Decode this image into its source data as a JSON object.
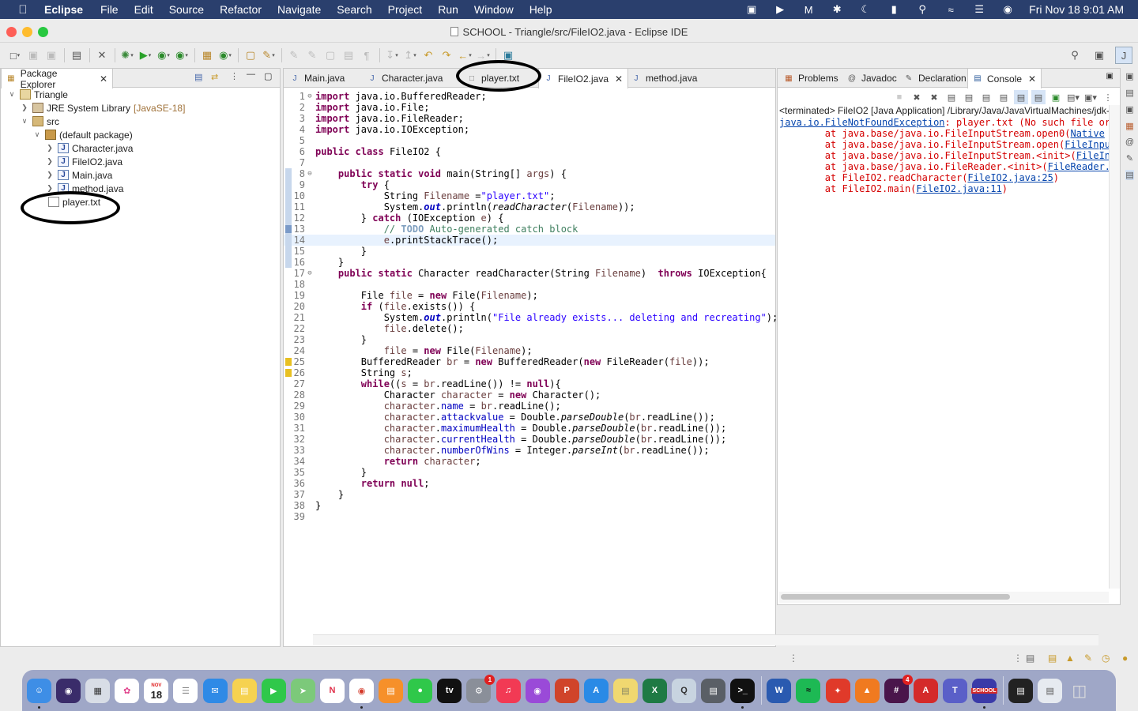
{
  "menubar": {
    "app": "Eclipse",
    "items": [
      "File",
      "Edit",
      "Source",
      "Refactor",
      "Navigate",
      "Search",
      "Project",
      "Run",
      "Window",
      "Help"
    ],
    "clock": "Fri Nov 18  9:01 AM"
  },
  "window": {
    "title": "SCHOOL - Triangle/src/FileIO2.java - Eclipse IDE"
  },
  "package_explorer": {
    "tab_label": "Package Explorer",
    "tree": [
      {
        "label": "Triangle",
        "suffix": "",
        "icon": "project-icon",
        "arrow": "v"
      },
      {
        "label": "JRE System Library",
        "suffix": "[JavaSE-18]",
        "icon": "jar-icon",
        "arrow": ">"
      },
      {
        "label": "src",
        "suffix": "",
        "icon": "source-folder-icon",
        "arrow": "v"
      },
      {
        "label": "(default package)",
        "suffix": "",
        "icon": "package-icon",
        "arrow": "v"
      },
      {
        "label": "Character.java",
        "suffix": "",
        "icon": "java-file-icon",
        "arrow": ">"
      },
      {
        "label": "FileIO2.java",
        "suffix": "",
        "icon": "java-file-icon",
        "arrow": ">"
      },
      {
        "label": "Main.java",
        "suffix": "",
        "icon": "java-file-icon",
        "arrow": ">"
      },
      {
        "label": "method.java",
        "suffix": "",
        "icon": "java-file-icon",
        "arrow": ">"
      },
      {
        "label": "player.txt",
        "suffix": "",
        "icon": "text-file-icon",
        "arrow": ""
      }
    ]
  },
  "editor": {
    "tabs": [
      {
        "label": "Main.java",
        "active": false
      },
      {
        "label": "Character.java",
        "active": false
      },
      {
        "label": "player.txt",
        "active": false
      },
      {
        "label": "FileIO2.java",
        "active": true
      },
      {
        "label": "method.java",
        "active": false
      }
    ],
    "lines": [
      "import java.io.BufferedReader;",
      "import java.io.File;",
      "import java.io.FileReader;",
      "import java.io.IOException;",
      "",
      "public class FileIO2 {",
      "",
      "    public static void main(String[] args) {",
      "        try {",
      "            String Filename =\"player.txt\";",
      "            System.out.println(readCharacter(Filename));",
      "        } catch (IOException e) {",
      "            // TODO Auto-generated catch block",
      "            e.printStackTrace();",
      "        }",
      "    }",
      "    public static Character readCharacter(String Filename)  throws IOException{",
      "",
      "        File file = new File(Filename);",
      "        if (file.exists()) {",
      "            System.out.println(\"File already exists... deleting and recreating\");",
      "            file.delete();",
      "        }",
      "            file = new File(Filename);",
      "        BufferedReader br = new BufferedReader(new FileReader(file));",
      "        String s;",
      "        while((s = br.readLine()) != null){",
      "            Character character = new Character();",
      "            character.name = br.readLine();",
      "            character.attackvalue = Double.parseDouble(br.readLine());",
      "            character.maximumHealth = Double.parseDouble(br.readLine());",
      "            character.currentHealth = Double.parseDouble(br.readLine());",
      "            character.numberOfWins = Integer.parseInt(br.readLine());",
      "            return character;",
      "        }",
      "        return null;",
      "    }",
      "}",
      ""
    ]
  },
  "console_panel": {
    "tabs": [
      {
        "label": "Problems",
        "icon": "problems-icon"
      },
      {
        "label": "Javadoc",
        "icon": "at-icon"
      },
      {
        "label": "Declaration",
        "icon": "declaration-icon"
      },
      {
        "label": "Console",
        "icon": "console-icon"
      }
    ],
    "terminated": "<terminated> FileIO2 [Java Application] /Library/Java/JavaVirtualMachines/jdk-18.0",
    "exception_link": "java.io.FileNotFoundException",
    "exception_msg": ": player.txt (No such file or",
    "stack": [
      {
        "prefix": "\tat java.base/java.io.FileInputStream.open0(",
        "link": "Native",
        "suffix": ""
      },
      {
        "prefix": "\tat java.base/java.io.FileInputStream.open(",
        "link": "FileInpu",
        "suffix": ""
      },
      {
        "prefix": "\tat java.base/java.io.FileInputStream.<init>(",
        "link": "FileIn",
        "suffix": ""
      },
      {
        "prefix": "\tat java.base/java.io.FileReader.<init>(",
        "link": "FileReader.",
        "suffix": ""
      },
      {
        "prefix": "\tat FileIO2.readCharacter(",
        "link": "FileIO2.java:25",
        "suffix": ")"
      },
      {
        "prefix": "\tat FileIO2.main(",
        "link": "FileIO2.java:11",
        "suffix": ")"
      }
    ]
  },
  "dock": {
    "calendar_month": "NOV",
    "calendar_day": "18",
    "settings_badge": "1",
    "slack_badge": "4",
    "school_label": "SCHOOL"
  }
}
